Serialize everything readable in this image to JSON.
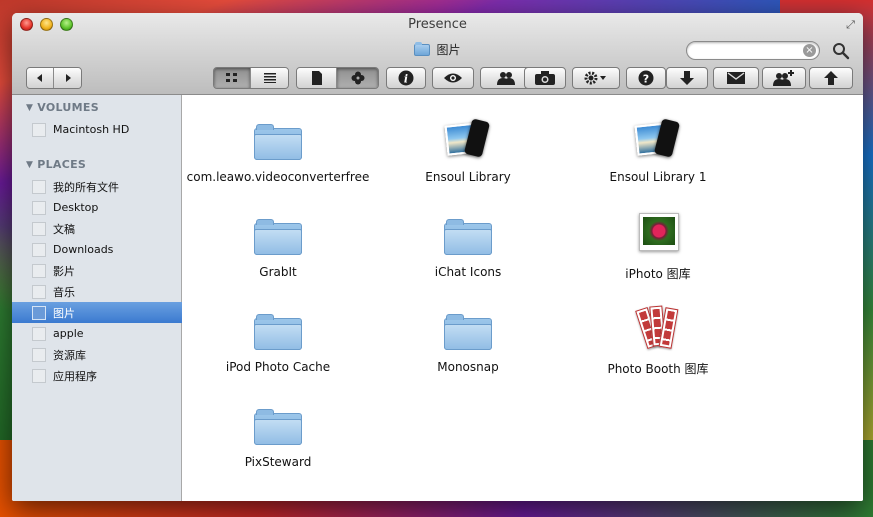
{
  "window": {
    "title": "Presence",
    "path_label": "图片"
  },
  "search": {
    "placeholder": "",
    "value": ""
  },
  "toolbar": {
    "back_icon": "back-arrow-icon",
    "forward_icon": "forward-arrow-icon",
    "view_modes": [
      "icon-view",
      "list-view"
    ],
    "buttons": [
      "new-document-icon",
      "flower-action-icon",
      "info-icon",
      "quick-look-eye-icon",
      "people-icon",
      "camera-icon",
      "gear-action-icon",
      "help-icon",
      "download-icon",
      "mail-icon",
      "add-people-icon",
      "upload-icon"
    ]
  },
  "sidebar": {
    "volumes_header": "VOLUMES",
    "volumes": [
      {
        "label": "Macintosh HD"
      }
    ],
    "places_header": "PLACES",
    "places": [
      {
        "label": "我的所有文件"
      },
      {
        "label": "Desktop"
      },
      {
        "label": "文稿"
      },
      {
        "label": "Downloads"
      },
      {
        "label": "影片"
      },
      {
        "label": "音乐"
      },
      {
        "label": "图片",
        "selected": true
      },
      {
        "label": "apple"
      },
      {
        "label": "资源库"
      },
      {
        "label": "应用程序"
      }
    ]
  },
  "items": [
    {
      "label": "com.leawo.videoconverterfree",
      "icon": "folder-icon"
    },
    {
      "label": "Ensoul Library",
      "icon": "photo-library-icon"
    },
    {
      "label": "Ensoul Library 1",
      "icon": "photo-library-icon"
    },
    {
      "label": "GrabIt",
      "icon": "folder-icon"
    },
    {
      "label": "iChat Icons",
      "icon": "folder-icon"
    },
    {
      "label": "iPhoto 图库",
      "icon": "iphoto-library-icon"
    },
    {
      "label": "iPod Photo Cache",
      "icon": "folder-icon"
    },
    {
      "label": "Monosnap",
      "icon": "folder-icon"
    },
    {
      "label": "Photo Booth 图库",
      "icon": "photo-booth-library-icon"
    },
    {
      "label": "PixSteward",
      "icon": "folder-icon"
    }
  ]
}
